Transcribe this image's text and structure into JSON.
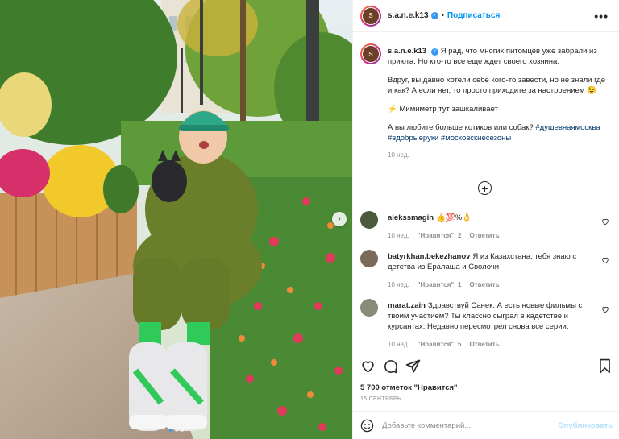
{
  "post": {
    "username": "s.a.n.e.k13",
    "header_separator": "•",
    "follow_label": "Подписаться",
    "more_label": "•••",
    "next_label": "›",
    "avatar_initials": "S",
    "caption": {
      "paragraphs": [
        "Я рад, что многих питомцев уже забрали из приюта. Но кто-то все еще ждет своего хозяина.",
        "Вдруг, вы давно хотели себе кого-то завести, но не знали где и как? А если нет, то просто приходите за настроением 😉",
        "⚡ Мимиметр тут зашкаливает"
      ],
      "last_text": "А вы любите больше котиков или собак?",
      "hashtags": [
        "#душевнаямосква",
        "#вдобрыеруки",
        "#московскиесезоны"
      ],
      "time": "10 нед."
    },
    "load_more_label": "+",
    "comments": [
      {
        "user": "alekssmagin",
        "text": "👍💯%👌",
        "time": "10 нед.",
        "likes": "\"Нравится\": 2",
        "reply": "Ответить",
        "avatar_color": "#4a5a3a"
      },
      {
        "user": "batyrkhan.bekezhanov",
        "text": "Я из Казахстана, тебя знаю с детства из Ералаша и Сволочи",
        "time": "10 нед.",
        "likes": "\"Нравится\": 1",
        "reply": "Ответить",
        "avatar_color": "#7a6a5a"
      },
      {
        "user": "marat.zain",
        "text": "Здравствуй Санек. А есть новые фильмы с твоим участием? Ты классно сыграл в кадетстве и курсантах. Недавно пересмотрел снова все серии.",
        "time": "10 нед.",
        "likes": "\"Нравится\": 5",
        "reply": "Ответить",
        "avatar_color": "#8a8a7a"
      }
    ],
    "likes_text": "5 700 отметок \"Нравится\"",
    "date": "15 СЕНТЯБРЬ",
    "add_comment_placeholder": "Добавьте комментарий...",
    "publish_label": "Опубликовать",
    "icons": [
      "heart-icon",
      "comment-icon",
      "share-icon",
      "bookmark-icon",
      "smile-icon",
      "verified-icon",
      "more-icon"
    ],
    "colors": {
      "accent": "#0095f6",
      "hashtag": "#00376b",
      "muted": "#8e8e8e",
      "publish_disabled": "#b2dffc"
    },
    "carousel": {
      "slides": 3,
      "active": 1
    }
  }
}
